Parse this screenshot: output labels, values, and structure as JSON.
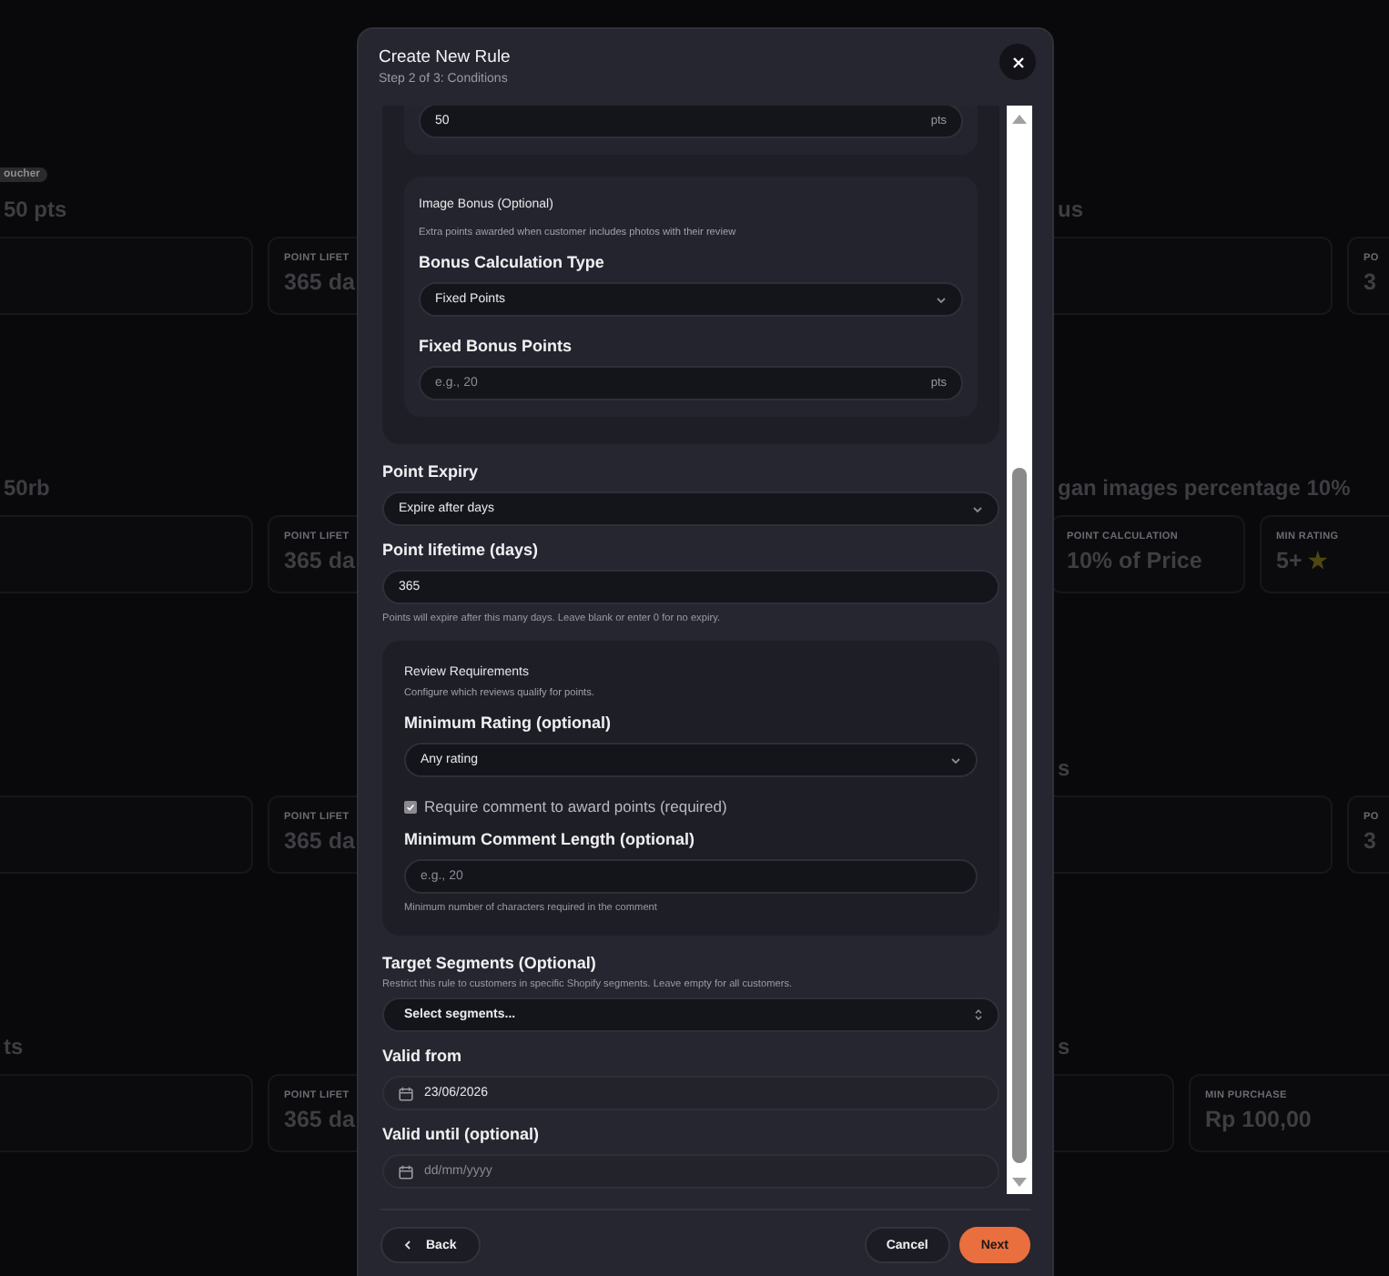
{
  "background_page": {
    "sections": [
      {
        "kind": "points",
        "left": {
          "badge": "oucher",
          "heading": "50 pts",
          "stats": [
            {
              "kind": "text",
              "label": "POINT LIFET",
              "value": "365 da"
            }
          ]
        },
        "right": {
          "heading": "us",
          "stats": [
            {
              "kind": "text",
              "label": "PO",
              "value": "3"
            }
          ]
        }
      },
      {
        "kind": "review",
        "left": {
          "heading": "50rb",
          "stats": [
            {
              "kind": "text",
              "label": "POINT LIFET",
              "value": "365 da"
            }
          ]
        },
        "right": {
          "heading": "gan images percentage 10%",
          "stats": [
            {
              "kind": "text",
              "label": "POINT CALCULATION",
              "value": "10% of Price"
            },
            {
              "kind": "rating",
              "label": "MIN RATING",
              "value": "5+",
              "star": "★"
            }
          ]
        }
      },
      {
        "kind": "points",
        "left": {
          "stats": [
            {
              "kind": "text",
              "label": "POINT LIFET",
              "value": "365 da"
            }
          ]
        },
        "right": {
          "heading": "s",
          "stats": [
            {
              "kind": "text",
              "label": "PO",
              "value": "3"
            }
          ]
        }
      },
      {
        "kind": "purchase",
        "left": {
          "heading": "ts",
          "stats": [
            {
              "kind": "text",
              "label": "POINT LIFET",
              "value": "365 da"
            }
          ]
        },
        "right": {
          "heading": "s",
          "stats": [
            {
              "kind": "text",
              "label": "MIN PURCHASE",
              "value": "Rp 100,00"
            }
          ]
        }
      }
    ]
  },
  "modal": {
    "title": "Create New Rule",
    "subtitle": "Step 2 of 3: Conditions"
  },
  "form": {
    "points_field": {
      "value": "50",
      "suffix": "pts"
    },
    "image_bonus": {
      "title": "Image Bonus (Optional)",
      "description": "Extra points awarded when customer includes photos with their review",
      "calc_label": "Bonus Calculation Type",
      "calc_value": "Fixed Points",
      "fixed_label": "Fixed Bonus Points",
      "fixed_placeholder": "e.g., 20",
      "fixed_suffix": "pts"
    },
    "expiry": {
      "label": "Point Expiry",
      "value": "Expire after days"
    },
    "lifetime": {
      "label": "Point lifetime (days)",
      "value": "365",
      "help": "Points will expire after this many days. Leave blank or enter 0 for no expiry."
    },
    "review": {
      "title": "Review Requirements",
      "description": "Configure which reviews qualify for points.",
      "rating_label": "Minimum Rating (optional)",
      "rating_value": "Any rating",
      "require_comment": {
        "label": "Require comment to award points (required)",
        "checked": true,
        "disabled": true
      },
      "length_label": "Minimum Comment Length (optional)",
      "length_placeholder": "e.g., 20",
      "length_help": "Minimum number of characters required in the comment"
    },
    "segments": {
      "label": "Target Segments (Optional)",
      "help": "Restrict this rule to customers in specific Shopify segments. Leave empty for all customers.",
      "placeholder": "Select segments..."
    },
    "valid_from": {
      "label": "Valid from",
      "value": "23/06/2026"
    },
    "valid_until": {
      "label": "Valid until (optional)",
      "placeholder": "dd/mm/yyyy"
    }
  },
  "footer": {
    "back": "Back",
    "cancel": "Cancel",
    "next": "Next"
  }
}
